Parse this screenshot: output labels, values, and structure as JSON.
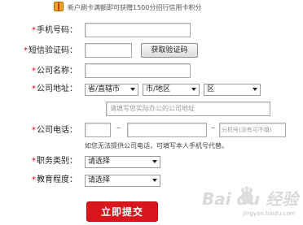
{
  "banner": {
    "icon": "gift-icon",
    "text": "新户刷卡满额即可获赠1500分招行信用卡积分"
  },
  "form": {
    "star": "*",
    "mobile": {
      "label": "手机号码：",
      "value": ""
    },
    "sms_code": {
      "label": "短信验证码：",
      "value": "",
      "button": "获取验证码"
    },
    "company_name": {
      "label": "公司名称：",
      "value": ""
    },
    "company_address": {
      "label": "公司地址：",
      "province": "省/直辖市",
      "city": "市/地区",
      "district": "区",
      "detail_placeholder": "请填写您实际办公的公司地址"
    },
    "company_phone": {
      "label": "公司电话：",
      "dash": "–",
      "extension_placeholder": "分机号(没有可不填)",
      "hint": "如您无法提供公司电话，可填写本人手机号代替。"
    },
    "job_type": {
      "label": "职务类别：",
      "selected": "请选择"
    },
    "education": {
      "label": "教育程度：",
      "selected": "请选择"
    },
    "submit": "立即提交"
  },
  "watermark": {
    "logo_text": "Bai du 经验",
    "url": "jingyan.baidu.com"
  }
}
